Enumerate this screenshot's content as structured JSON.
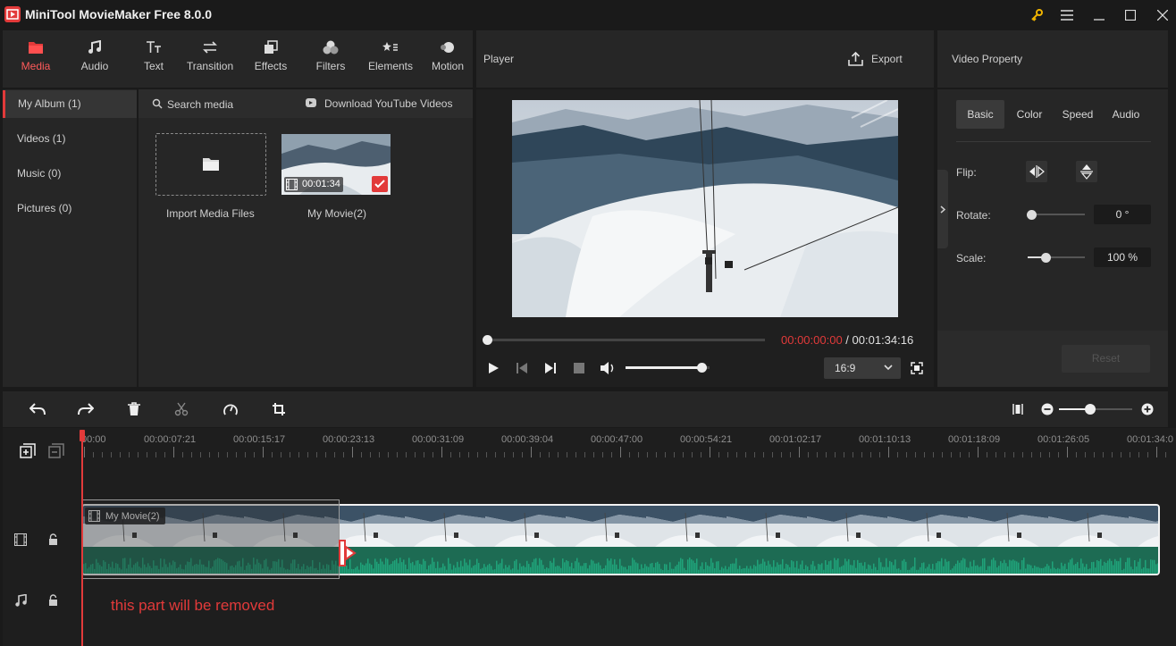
{
  "window": {
    "title": "MiniTool MovieMaker Free 8.0.0"
  },
  "toolbar": {
    "tabs": [
      {
        "label": "Media",
        "active": true,
        "icon": "folder-icon"
      },
      {
        "label": "Audio",
        "icon": "music-note-icon"
      },
      {
        "label": "Text",
        "icon": "text-icon"
      },
      {
        "label": "Transition",
        "icon": "transition-arrows-icon"
      },
      {
        "label": "Effects",
        "icon": "effects-icon"
      },
      {
        "label": "Filters",
        "icon": "filters-icon"
      },
      {
        "label": "Elements",
        "icon": "elements-icon"
      },
      {
        "label": "Motion",
        "icon": "motion-icon"
      }
    ]
  },
  "album": {
    "items": [
      {
        "label": "My Album (1)",
        "active": true
      },
      {
        "label": "Videos (1)"
      },
      {
        "label": "Music (0)"
      },
      {
        "label": "Pictures (0)"
      }
    ]
  },
  "media": {
    "search_placeholder": "Search media",
    "download_label": "Download YouTube Videos",
    "import_label": "Import Media Files",
    "clip": {
      "name": "My Movie(2)",
      "duration": "00:01:34"
    }
  },
  "player": {
    "title": "Player",
    "export_label": "Export",
    "current_time": "00:00:00:00",
    "separator": " / ",
    "total_time": "00:01:34:16",
    "aspect": "16:9",
    "volume_fraction": 0.9,
    "progress_fraction": 0.0
  },
  "props": {
    "title": "Video Property",
    "tabs": [
      "Basic",
      "Color",
      "Speed",
      "Audio"
    ],
    "flip_label": "Flip:",
    "rotate_label": "Rotate:",
    "rotate_value": "0 °",
    "scale_label": "Scale:",
    "scale_value": "100 %",
    "reset_label": "Reset"
  },
  "timeline": {
    "ruler_labels": [
      "00:00",
      "00:00:07:21",
      "00:00:15:17",
      "00:00:23:13",
      "00:00:31:09",
      "00:00:39:04",
      "00:00:47:00",
      "00:00:54:21",
      "00:01:02:17",
      "00:01:10:13",
      "00:01:18:09",
      "00:01:26:05",
      "00:01:34:0"
    ],
    "clip_name": "My Movie(2)",
    "annotation": "this part will be removed"
  },
  "colors": {
    "accent": "#e23a3a",
    "audio_wave": "#1fa37a",
    "panel": "#262626"
  }
}
